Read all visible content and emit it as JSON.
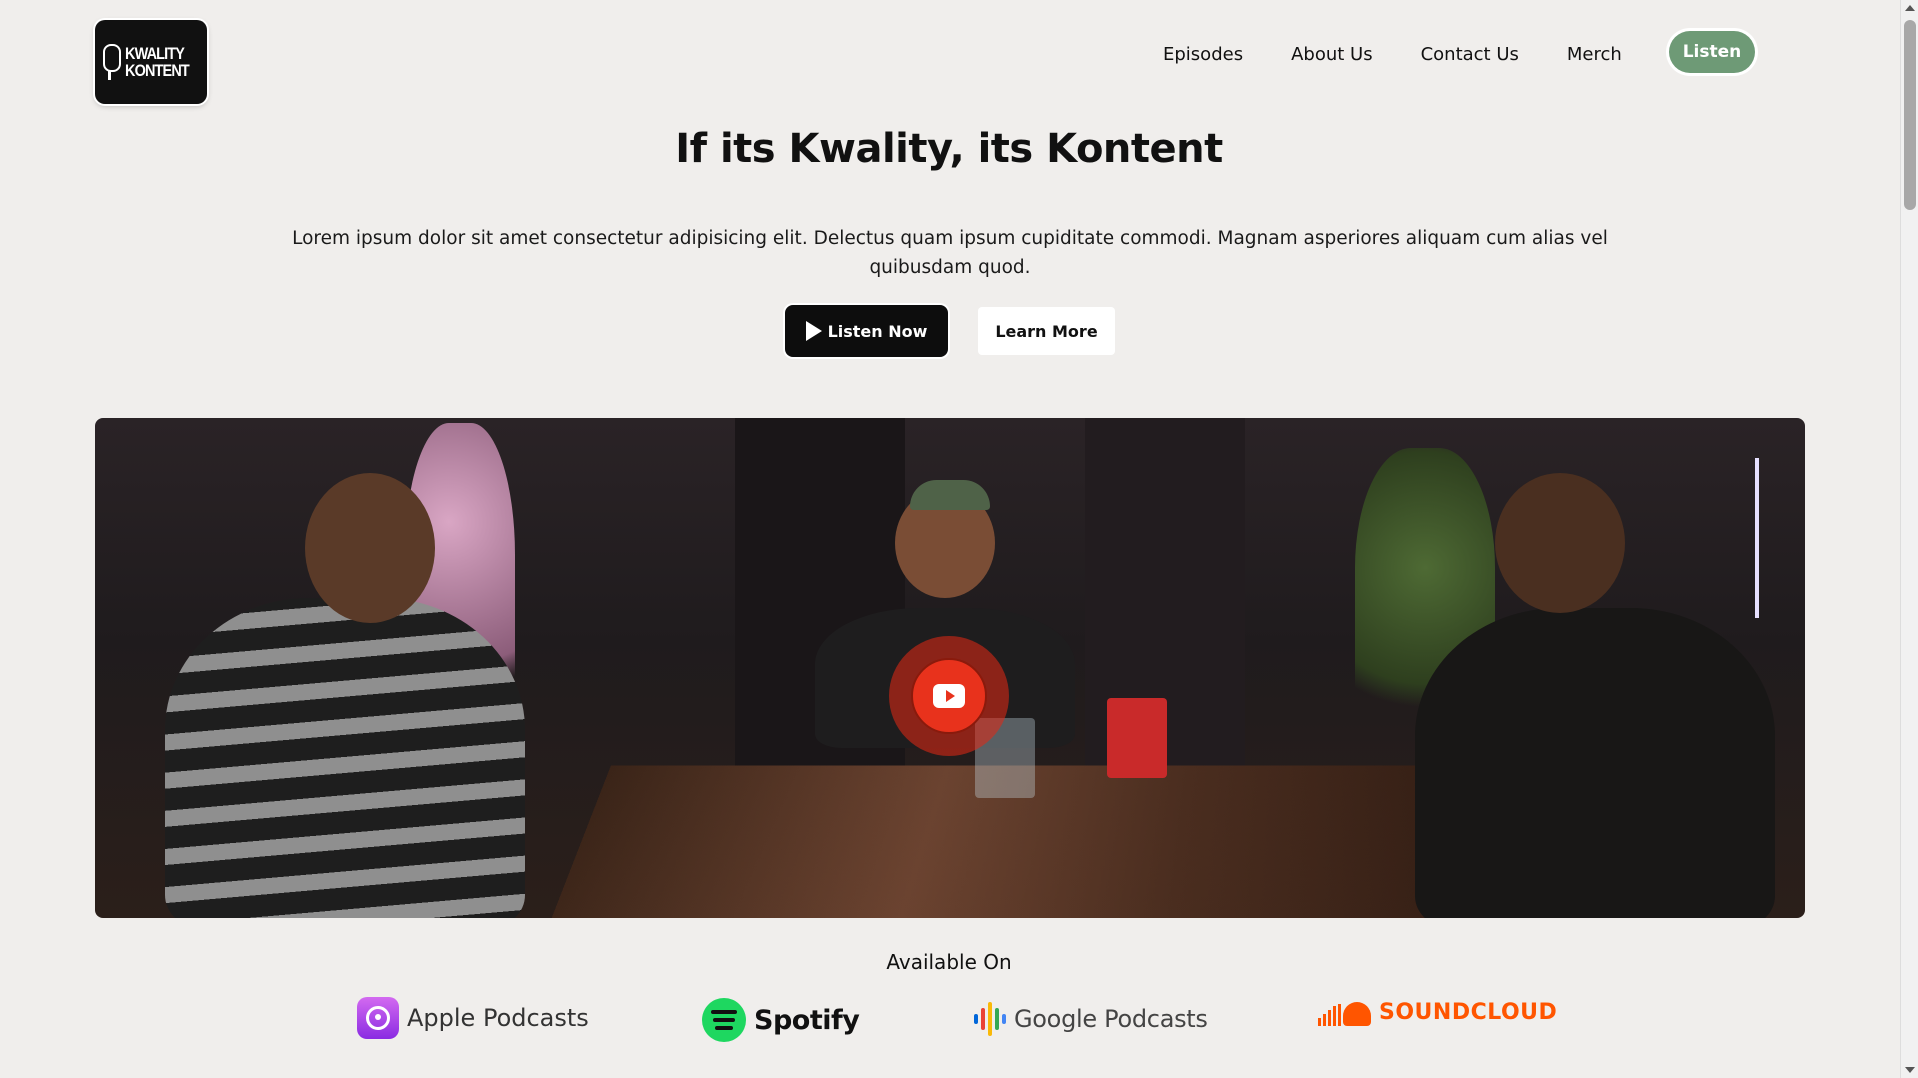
{
  "header": {
    "logo_lines": [
      "KWALITY",
      "KONTENT"
    ],
    "nav": [
      "Episodes",
      "About Us",
      "Contact Us",
      "Merch"
    ],
    "listen_label": "Listen",
    "listen_color": "#6e9a76"
  },
  "hero": {
    "title": "If its Kwality, its Kontent",
    "description": "Lorem ipsum dolor sit amet consectetur adipisicing elit. Delectus quam ipsum cupiditate commodi. Magnam asperiores aliquam cum alias vel quibusdam quod.",
    "primary_button": "Listen Now",
    "secondary_button": "Learn More"
  },
  "video": {
    "play_icon": "youtube-play-icon",
    "accent_color": "#e8321c"
  },
  "available": {
    "title": "Available On",
    "platforms": [
      {
        "name": "Apple Podcasts",
        "icon": "apple-podcasts-icon",
        "color": "#9b3fe6"
      },
      {
        "name": "Spotify",
        "icon": "spotify-icon",
        "color": "#1ed760"
      },
      {
        "name": "Google Podcasts",
        "icon": "google-podcasts-icon",
        "color": "#4285f4"
      },
      {
        "name": "SOUNDCLOUD",
        "icon": "soundcloud-icon",
        "color": "#ff5500"
      }
    ]
  }
}
